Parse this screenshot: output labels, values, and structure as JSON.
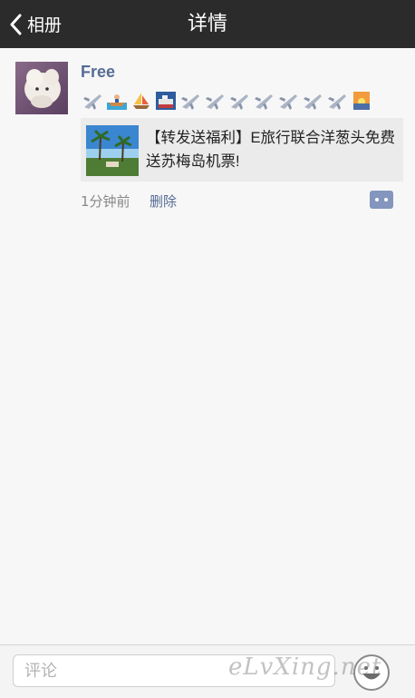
{
  "navbar": {
    "back_label": "相册",
    "title": "详情"
  },
  "post": {
    "username": "Free",
    "emojis": [
      "airplane-icon",
      "rowboat-icon",
      "sailboat-icon",
      "ship-card-icon",
      "airplane-icon",
      "airplane-icon",
      "airplane-icon",
      "airplane-icon",
      "airplane-icon",
      "airplane-icon",
      "airplane-icon",
      "sunset-icon"
    ],
    "link_text": "【转发送福利】E旅行联合洋葱头免费送苏梅岛机票!",
    "time": "1分钟前",
    "delete_label": "删除"
  },
  "bottom": {
    "comment_placeholder": "评论",
    "watermark": "eLvXing.net"
  }
}
